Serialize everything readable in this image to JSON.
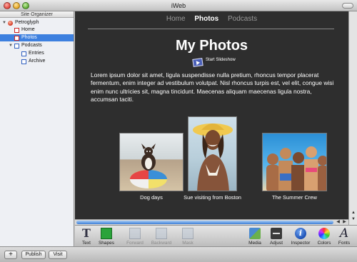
{
  "window": {
    "title": "iWeb"
  },
  "sidebar": {
    "header": "Site Organizer",
    "items": [
      {
        "label": "Petroglyph",
        "kind": "site",
        "expanded": true
      },
      {
        "label": "Home",
        "kind": "page"
      },
      {
        "label": "Photos",
        "kind": "page",
        "selected": true
      },
      {
        "label": "Podcasts",
        "kind": "blog",
        "expanded": true
      },
      {
        "label": "Entries",
        "kind": "blog-page"
      },
      {
        "label": "Archive",
        "kind": "blog-page"
      }
    ]
  },
  "canvas": {
    "nav": [
      "Home",
      "Photos",
      "Podcasts"
    ],
    "nav_current": "Photos",
    "title": "My Photos",
    "slideshow_label": "Start Slideshow",
    "intro": "Lorem ipsum dolor sit amet, ligula suspendisse nulla pretium, rhoncus tempor placerat fermentum, enim integer ad vestibulum volutpat. Nisl rhoncus turpis est, vel elit, congue wisi enim nunc ultricies sit, magna tincidunt. Maecenas aliquam maecenas ligula nostra, accumsan taciti.",
    "photos": [
      {
        "caption": "Dog days"
      },
      {
        "caption": "Sue visiting from Boston"
      },
      {
        "caption": "The Summer Crew"
      }
    ]
  },
  "toolbar": {
    "tools": [
      {
        "label": "Text",
        "icon": "text-icon"
      },
      {
        "label": "Shapes",
        "icon": "shapes-icon"
      },
      {
        "label": "Forward",
        "icon": "forward-icon",
        "enabled": false
      },
      {
        "label": "Backward",
        "icon": "backward-icon",
        "enabled": false
      },
      {
        "label": "Mask",
        "icon": "mask-icon",
        "enabled": false
      },
      {
        "label": "Media",
        "icon": "media-icon"
      },
      {
        "label": "Adjust",
        "icon": "adjust-icon"
      },
      {
        "label": "Inspector",
        "icon": "inspector-icon"
      },
      {
        "label": "Colors",
        "icon": "colors-icon"
      },
      {
        "label": "Fonts",
        "icon": "fonts-icon"
      }
    ]
  },
  "footer": {
    "add_label": "+",
    "publish_label": "Publish",
    "visit_label": "Visit"
  },
  "colors": {
    "canvas_background": "#2e2e2e",
    "selection": "#3d80df",
    "scroll_thumb": "#3d7fd8"
  }
}
